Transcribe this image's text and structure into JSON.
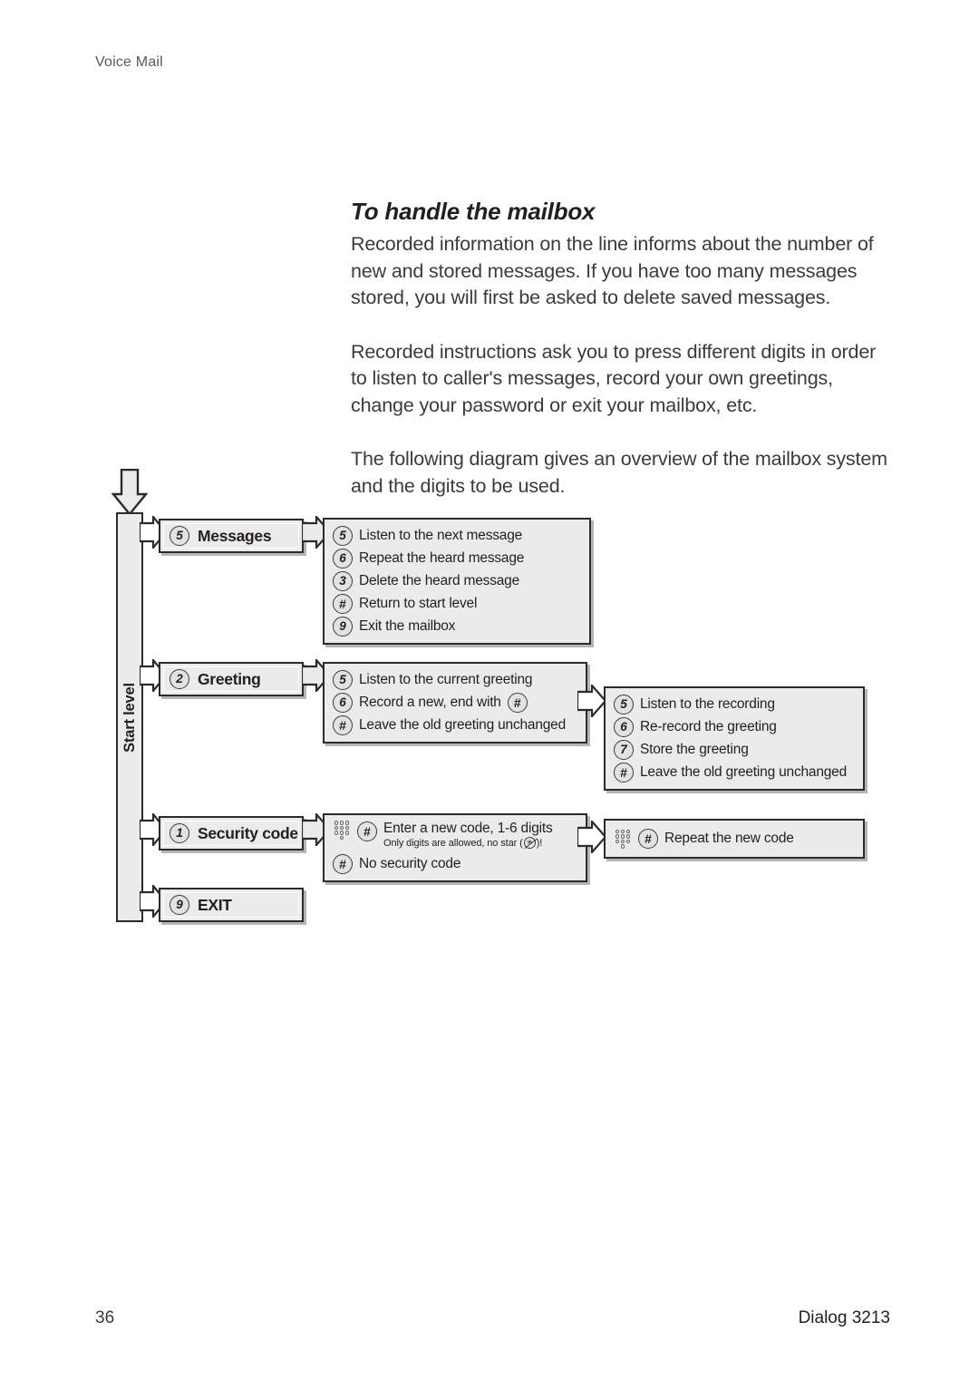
{
  "running_head": "Voice Mail",
  "section": {
    "title": "To handle the mailbox",
    "paragraphs": [
      "Recorded information on the line informs about the number of new and stored messages. If you have too many messages stored, you will first be asked to delete saved messages.",
      "Recorded instructions ask you to press different digits in order to listen to caller's messages, record your own greetings, change your password or exit your mailbox, etc.",
      "The following diagram gives an overview of the mailbox system and the digits to be used."
    ]
  },
  "diagram": {
    "start_level_label": "Start level",
    "entry_arrow_icon": "down-block-arrow-icon",
    "keypad_icon": "keypad-icon",
    "messages": {
      "key": "5",
      "label": "Messages",
      "options": [
        {
          "key": "5",
          "text": "Listen to the next message"
        },
        {
          "key": "6",
          "text": "Repeat the heard message"
        },
        {
          "key": "3",
          "text": "Delete the heard message"
        },
        {
          "key": "#",
          "text": "Return to start level"
        },
        {
          "key": "9",
          "text": "Exit the mailbox"
        }
      ]
    },
    "greeting": {
      "key": "2",
      "label": "Greeting",
      "options": [
        {
          "key": "5",
          "text": "Listen to the current greeting"
        },
        {
          "key": "6",
          "text": "Record a new, end with",
          "trailing_key": "#"
        },
        {
          "key": "#",
          "text": "Leave the old greeting unchanged"
        }
      ],
      "sub_options": [
        {
          "key": "5",
          "text": "Listen to the recording"
        },
        {
          "key": "6",
          "text": "Re-record the greeting"
        },
        {
          "key": "7",
          "text": "Store the greeting"
        },
        {
          "key": "#",
          "text": "Leave the old greeting unchanged"
        }
      ]
    },
    "security": {
      "key": "1",
      "label": "Security code",
      "enter_key": "#",
      "enter_text": "Enter a new code, 1-6 digits",
      "note_before": "Only digits are allowed, no star (",
      "note_star": "✳",
      "note_after": ")!",
      "no_code_key": "#",
      "no_code_text": "No security code",
      "repeat_key": "#",
      "repeat_text": "Repeat the new code"
    },
    "exit": {
      "key": "9",
      "label": "EXIT"
    }
  },
  "footer": {
    "page_number": "36",
    "model": "Dialog 3213"
  }
}
